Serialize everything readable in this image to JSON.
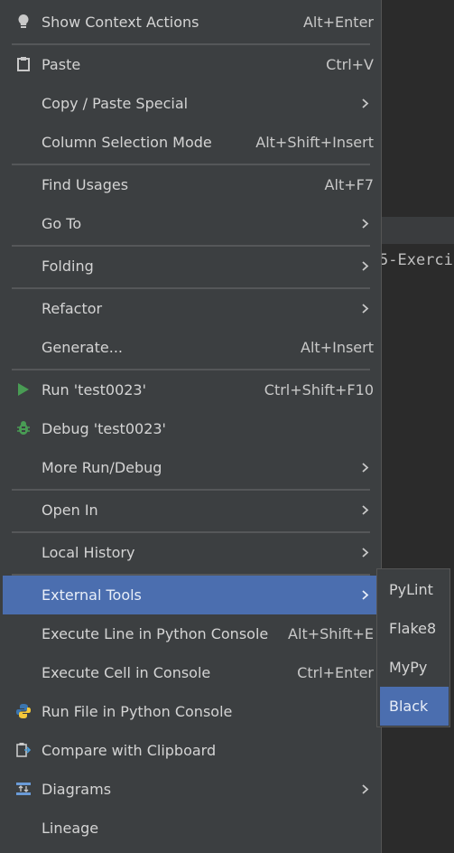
{
  "background": {
    "code_text": "5-Exerci"
  },
  "menu": {
    "items": [
      {
        "label": "Show Context Actions",
        "shortcut": "Alt+Enter",
        "icon": "bulb-icon"
      },
      {
        "label": "Paste",
        "shortcut": "Ctrl+V",
        "icon": "clipboard-icon"
      },
      {
        "label": "Copy / Paste Special",
        "shortcut": "",
        "icon": ""
      },
      {
        "label": "Column Selection Mode",
        "shortcut": "Alt+Shift+Insert",
        "icon": ""
      },
      {
        "label": "Find Usages",
        "shortcut": "Alt+F7",
        "icon": ""
      },
      {
        "label": "Go To",
        "shortcut": "",
        "icon": ""
      },
      {
        "label": "Folding",
        "shortcut": "",
        "icon": ""
      },
      {
        "label": "Refactor",
        "shortcut": "",
        "icon": ""
      },
      {
        "label": "Generate...",
        "shortcut": "Alt+Insert",
        "icon": ""
      },
      {
        "label": "Run 'test0023'",
        "shortcut": "Ctrl+Shift+F10",
        "icon": "run-icon"
      },
      {
        "label": "Debug 'test0023'",
        "shortcut": "",
        "icon": "debug-icon"
      },
      {
        "label": "More Run/Debug",
        "shortcut": "",
        "icon": ""
      },
      {
        "label": "Open In",
        "shortcut": "",
        "icon": ""
      },
      {
        "label": "Local History",
        "shortcut": "",
        "icon": ""
      },
      {
        "label": "External Tools",
        "shortcut": "",
        "icon": ""
      },
      {
        "label": "Execute Line in Python Console",
        "shortcut": "Alt+Shift+E",
        "icon": ""
      },
      {
        "label": "Execute Cell in Console",
        "shortcut": "Ctrl+Enter",
        "icon": ""
      },
      {
        "label": "Run File in Python Console",
        "shortcut": "",
        "icon": "python-icon"
      },
      {
        "label": "Compare with Clipboard",
        "shortcut": "",
        "icon": "compare-icon"
      },
      {
        "label": "Diagrams",
        "shortcut": "",
        "icon": "diagram-icon"
      },
      {
        "label": "Lineage",
        "shortcut": "",
        "icon": ""
      }
    ]
  },
  "submenu": {
    "items": [
      {
        "label": "PyLint"
      },
      {
        "label": "Flake8"
      },
      {
        "label": "MyPy"
      },
      {
        "label": "Black"
      }
    ]
  },
  "colors": {
    "selection": "#4b6eaf",
    "menu_bg": "#3c3f41",
    "run_green": "#499c54"
  }
}
